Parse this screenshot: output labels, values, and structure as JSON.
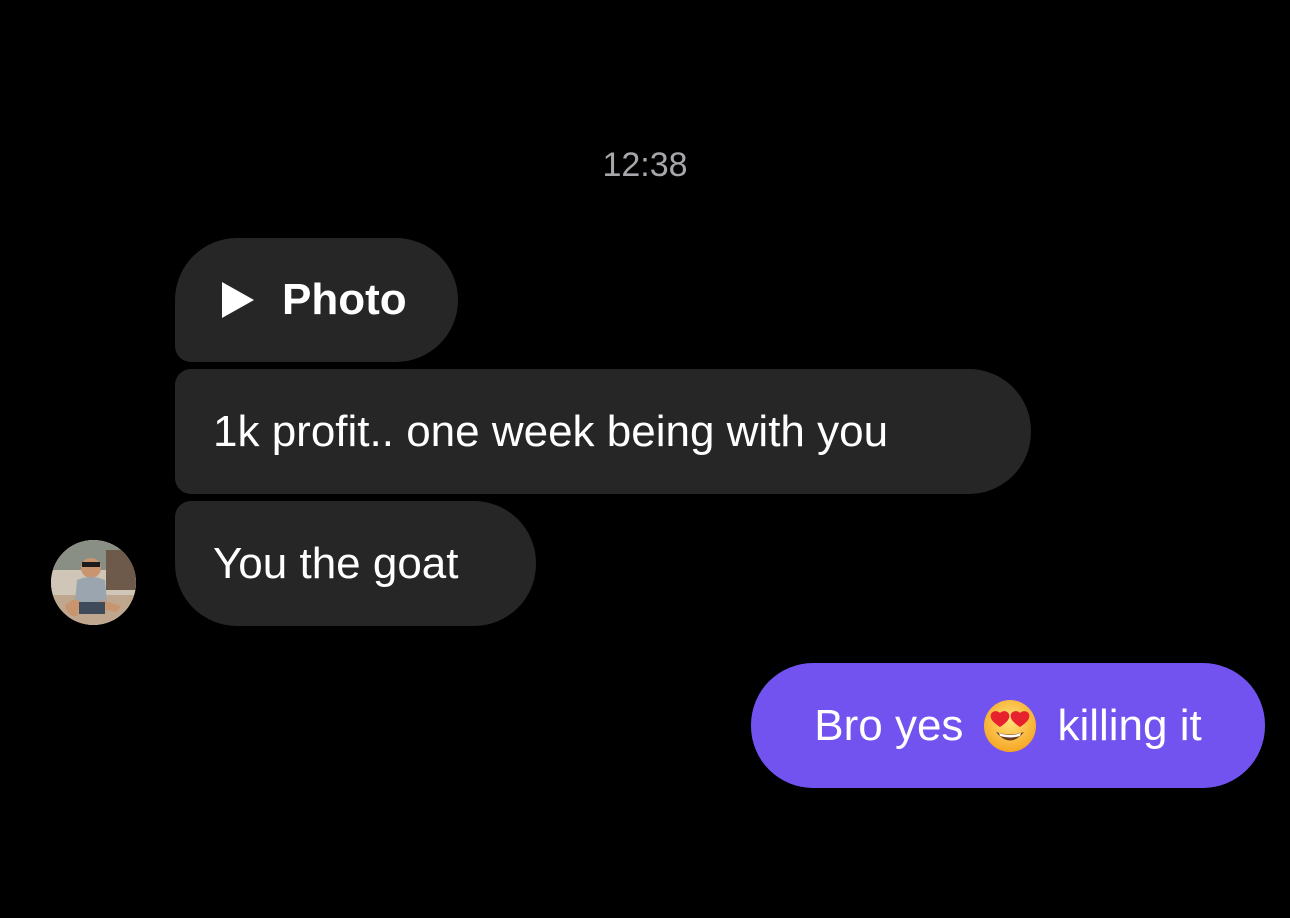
{
  "chat": {
    "timestamp": "12:38",
    "received": [
      {
        "type": "photo",
        "label": "Photo",
        "icon": "play-icon"
      },
      {
        "type": "text",
        "text": "1k profit.. one week being with you"
      },
      {
        "type": "text",
        "text": "You the goat"
      }
    ],
    "sent": {
      "text_before": "Bro yes",
      "emoji": "heart-eyes-emoji",
      "text_after": "killing it"
    }
  },
  "colors": {
    "background": "#000000",
    "received_bubble": "#262626",
    "sent_bubble": "#7353f0",
    "timestamp_text": "#a7a7ab"
  }
}
